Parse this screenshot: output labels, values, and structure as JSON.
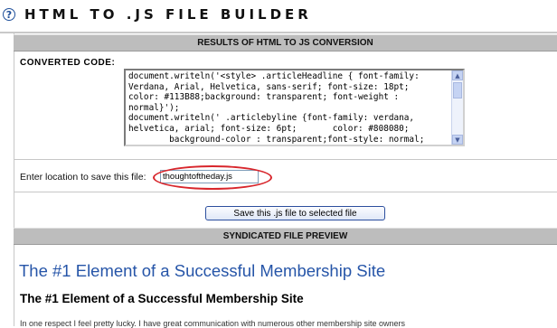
{
  "app": {
    "title": "HTML TO .JS FILE BUILDER",
    "help_icon": "question-circle-icon"
  },
  "results": {
    "header": "RESULTS OF HTML TO JS CONVERSION",
    "converted_label": "CONVERTED CODE:",
    "code": "document.writeln('<style> .articleHeadline { font-family:\nVerdana, Arial, Helvetica, sans-serif; font-size: 18pt;\ncolor: #113B88;background: transparent; font-weight :\nnormal}');\ndocument.writeln(' .articlebyline {font-family: verdana,\nhelvetica, arial; font-size: 6pt;       color: #808080;\n        background-color : transparent;font-style: normal;"
  },
  "save": {
    "label": "Enter location to save this file:",
    "value": "thoughtoftheday.js",
    "button_label": "Save this .js file to selected file"
  },
  "preview": {
    "header": "SYNDICATED FILE PREVIEW",
    "title": "The #1 Element of a Successful Membership Site",
    "subtitle": "The #1 Element of a Successful Membership Site",
    "body": "In one respect I feel pretty lucky. I have great communication with numerous other membership site owners"
  },
  "colors": {
    "section_header_bg": "#bdbdbd",
    "preview_title": "#2655a8",
    "highlight_oval": "#d8262c",
    "button_border": "#2c4f9e"
  }
}
